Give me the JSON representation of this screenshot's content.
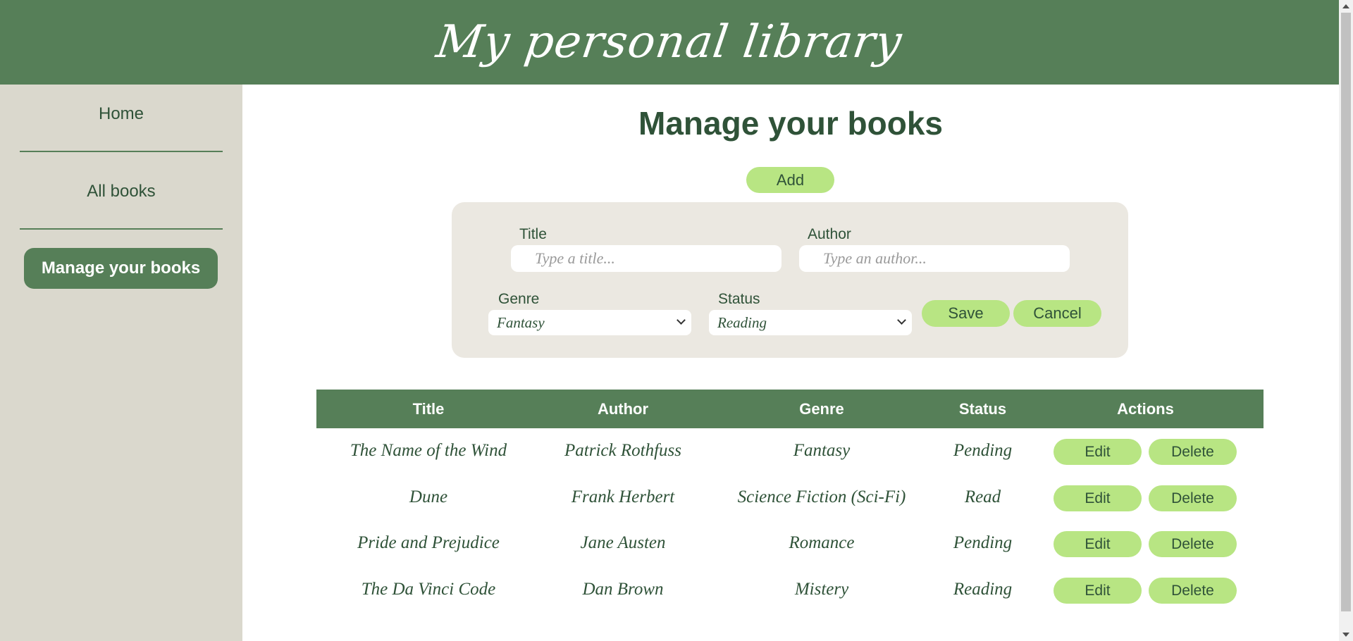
{
  "header": {
    "title": "My personal library"
  },
  "sidebar": {
    "items": [
      {
        "label": "Home"
      },
      {
        "label": "All books"
      },
      {
        "label": "Manage your books",
        "active": true
      }
    ]
  },
  "main": {
    "title": "Manage your books",
    "add_label": "Add",
    "form": {
      "title_label": "Title",
      "title_placeholder": "Type a title...",
      "author_label": "Author",
      "author_placeholder": "Type an author...",
      "genre_label": "Genre",
      "genre_value": "Fantasy",
      "status_label": "Status",
      "status_value": "Reading",
      "save_label": "Save",
      "cancel_label": "Cancel"
    },
    "table": {
      "headers": [
        "Title",
        "Author",
        "Genre",
        "Status",
        "Actions"
      ],
      "rows": [
        {
          "title": "The Name of the Wind",
          "author": "Patrick Rothfuss",
          "genre": "Fantasy",
          "status": "Pending"
        },
        {
          "title": "Dune",
          "author": "Frank Herbert",
          "genre": "Science Fiction (Sci-Fi)",
          "status": "Read"
        },
        {
          "title": "Pride and Prejudice",
          "author": "Jane Austen",
          "genre": "Romance",
          "status": "Pending"
        },
        {
          "title": "The Da Vinci Code",
          "author": "Dan Brown",
          "genre": "Mistery",
          "status": "Reading"
        }
      ],
      "edit_label": "Edit",
      "delete_label": "Delete"
    }
  },
  "colors": {
    "primary": "#567f58",
    "sidebar_bg": "#dad8cd",
    "panel_bg": "#ebe8e1",
    "button": "#b8e583",
    "text": "#2f5238"
  }
}
